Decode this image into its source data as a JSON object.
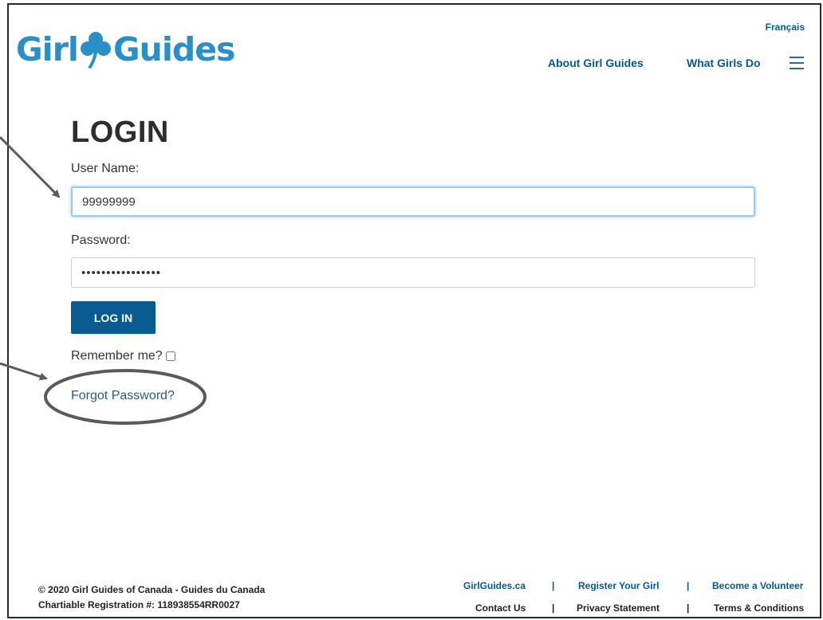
{
  "header": {
    "logo_text_left": "Girl",
    "logo_text_right": "Guides",
    "language_link": "Français",
    "nav": [
      {
        "label": "About Girl Guides"
      },
      {
        "label": "What Girls Do"
      }
    ],
    "menu_icon": "hamburger-icon"
  },
  "login": {
    "title": "LOGIN",
    "username_label": "User Name:",
    "username_value": "99999999",
    "password_label": "Password:",
    "password_value": "••••••••••••••••",
    "submit_label": "LOG IN",
    "remember_label": "Remember me?",
    "remember_checked": false,
    "forgot_label": "Forgot Password?"
  },
  "footer": {
    "copyright": "© 2020 Girl Guides of Canada - Guides du Canada",
    "registration": "Chartiable Registration #: 118938554RR0027",
    "links_row1": [
      "GirlGuides.ca",
      "Register Your Girl",
      "Become a Volunteer"
    ],
    "links_row2": [
      "Contact Us",
      "Privacy Statement",
      "Terms & Conditions"
    ],
    "separator": "|"
  },
  "colors": {
    "brand_blue": "#2a8fc9",
    "link_blue": "#005a94",
    "button_blue": "#0a5b92",
    "annotation_gray": "#5a5a5a"
  }
}
